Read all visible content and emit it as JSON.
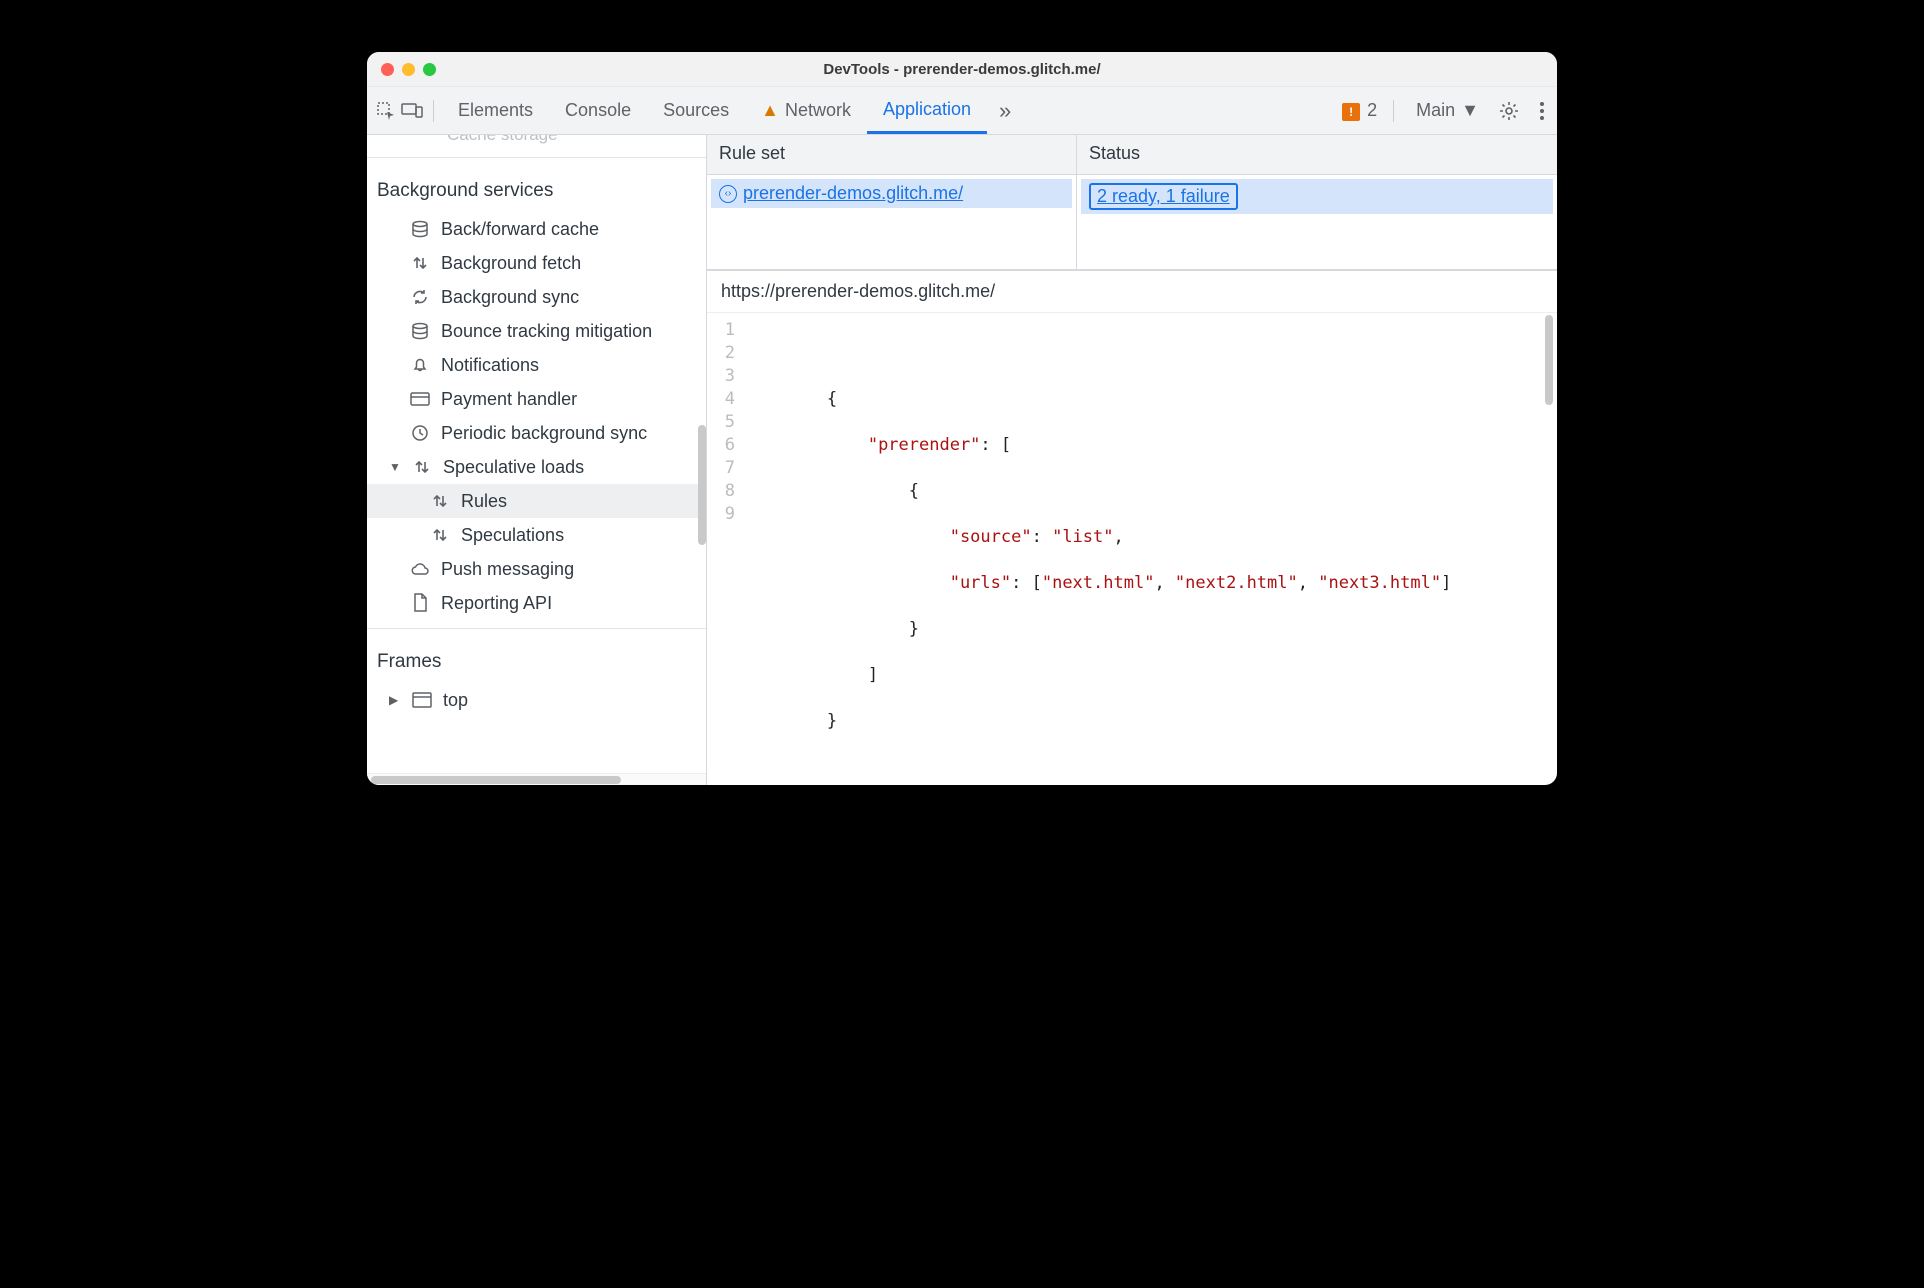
{
  "window": {
    "title": "DevTools - prerender-demos.glitch.me/"
  },
  "tabs": {
    "elements": "Elements",
    "console": "Console",
    "sources": "Sources",
    "network": "Network",
    "application": "Application"
  },
  "toolbar": {
    "issue_count": "2",
    "target_label": "Main"
  },
  "sidebar": {
    "truncated_top": "Cache storage",
    "bg_services_title": "Background services",
    "items": {
      "bfcache": "Back/forward cache",
      "bgfetch": "Background fetch",
      "bgsync": "Background sync",
      "bounce": "Bounce tracking mitigation",
      "notif": "Notifications",
      "payment": "Payment handler",
      "periodic": "Periodic background sync",
      "specloads": "Speculative loads",
      "rules": "Rules",
      "speculations": "Speculations",
      "push": "Push messaging",
      "reporting": "Reporting API"
    },
    "frames_title": "Frames",
    "frames_top": "top"
  },
  "grid": {
    "col_rule": "Rule set",
    "col_status": "Status",
    "row_rule": " prerender-demos.glitch.me/",
    "row_status": "2 ready, 1 failure"
  },
  "details": {
    "url": "https://prerender-demos.glitch.me/",
    "lines": [
      "1",
      "2",
      "3",
      "4",
      "5",
      "6",
      "7",
      "8",
      "9"
    ],
    "code": {
      "l2_open": "{",
      "l3_key": "\"prerender\"",
      "l3_after": ": [",
      "l4": "{",
      "l5_key": "\"source\"",
      "l5_val": "\"list\"",
      "l6_key": "\"urls\"",
      "l6_v1": "\"next.html\"",
      "l6_v2": "\"next2.html\"",
      "l6_v3": "\"next3.html\"",
      "l7": "}",
      "l8": "]",
      "l9": "}"
    }
  }
}
